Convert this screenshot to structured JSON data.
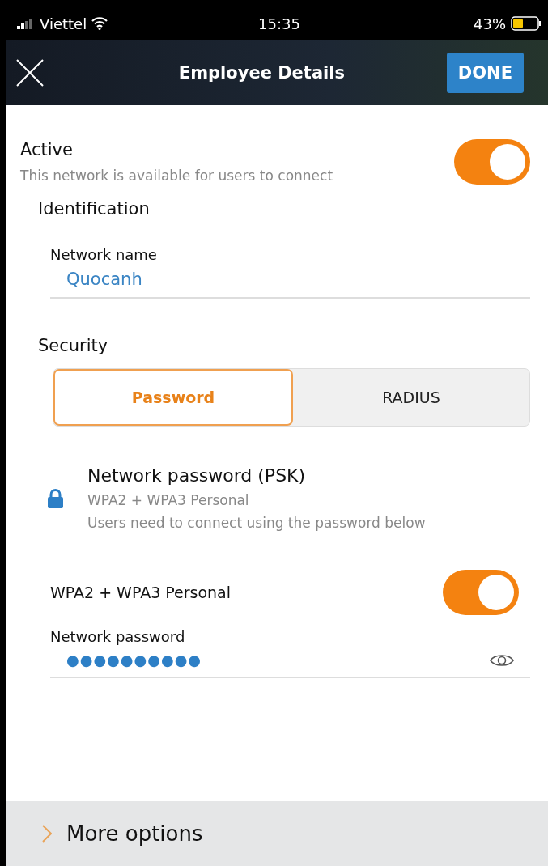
{
  "status_bar": {
    "carrier": "Viettel",
    "time": "15:35",
    "battery": "43%"
  },
  "header": {
    "title": "Employee Details",
    "done": "DONE"
  },
  "active": {
    "label": "Active",
    "description": "This network is available for users to connect",
    "on": true
  },
  "identification": {
    "heading": "Identification",
    "field_label": "Network name",
    "value": "Quocanh"
  },
  "security": {
    "heading": "Security",
    "tabs": [
      {
        "label": "Password",
        "selected": true
      },
      {
        "label": "RADIUS",
        "selected": false
      }
    ],
    "option": {
      "title": "Network password (PSK)",
      "subtitle": "WPA2 + WPA3 Personal",
      "description": "Users need to connect using the password below"
    },
    "wpa": {
      "label": "WPA2 + WPA3 Personal",
      "on": true
    },
    "password": {
      "label": "Network password",
      "value": "●●●●●●●●●●"
    }
  },
  "more_options": {
    "label": "More options",
    "expanded": false
  }
}
